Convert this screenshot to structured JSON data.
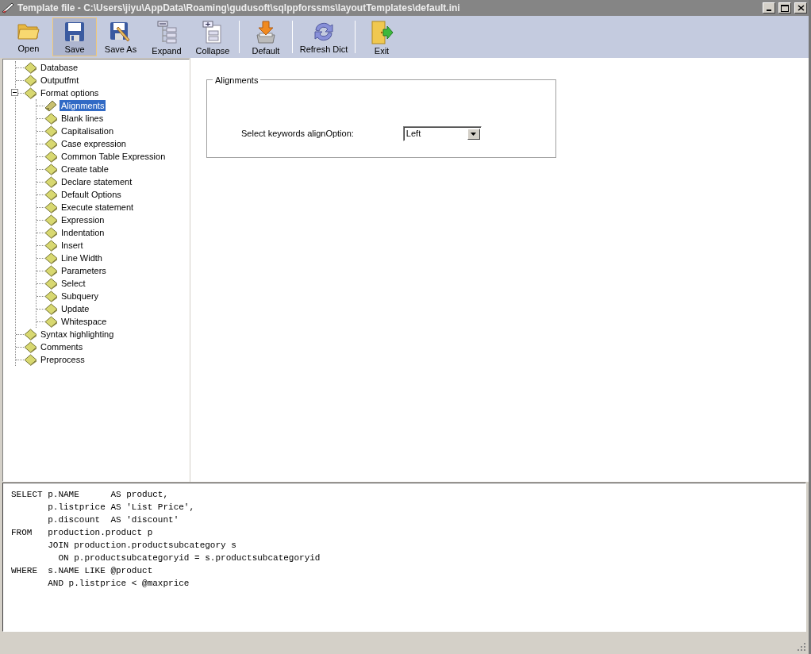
{
  "window": {
    "title": "Template file  - C:\\Users\\jiyu\\AppData\\Roaming\\gudusoft\\sqlppforssms\\layoutTemplates\\default.ini"
  },
  "toolbar": [
    {
      "kind": "button",
      "label": "Open",
      "selected": false
    },
    {
      "kind": "button",
      "label": "Save",
      "selected": true
    },
    {
      "kind": "button",
      "label": "Save As",
      "selected": false
    },
    {
      "kind": "button",
      "label": "Expand",
      "selected": false
    },
    {
      "kind": "button",
      "label": "Collapse",
      "selected": false
    },
    {
      "kind": "separator"
    },
    {
      "kind": "button",
      "label": "Default",
      "selected": false
    },
    {
      "kind": "separator"
    },
    {
      "kind": "button",
      "label": "Refresh Dict",
      "selected": false
    },
    {
      "kind": "separator"
    },
    {
      "kind": "button",
      "label": "Exit",
      "selected": false
    }
  ],
  "tree": [
    {
      "label": "Database",
      "selected": false
    },
    {
      "label": "Outputfmt",
      "selected": false
    },
    {
      "label": "Format options",
      "selected": false,
      "expanded": true,
      "children": [
        {
          "label": "Alignments",
          "selected": true
        },
        {
          "label": "Blank lines",
          "selected": false
        },
        {
          "label": "Capitalisation",
          "selected": false
        },
        {
          "label": "Case expression",
          "selected": false
        },
        {
          "label": "Common Table Expression",
          "selected": false
        },
        {
          "label": "Create table",
          "selected": false
        },
        {
          "label": "Declare statement",
          "selected": false
        },
        {
          "label": "Default Options",
          "selected": false
        },
        {
          "label": "Execute statement",
          "selected": false
        },
        {
          "label": "Expression",
          "selected": false
        },
        {
          "label": "Indentation",
          "selected": false
        },
        {
          "label": "Insert",
          "selected": false
        },
        {
          "label": "Line Width",
          "selected": false
        },
        {
          "label": "Parameters",
          "selected": false
        },
        {
          "label": "Select",
          "selected": false
        },
        {
          "label": "Subquery",
          "selected": false
        },
        {
          "label": "Update",
          "selected": false
        },
        {
          "label": "Whitespace",
          "selected": false
        }
      ]
    },
    {
      "label": "Syntax highlighting",
      "selected": false
    },
    {
      "label": "Comments",
      "selected": false
    },
    {
      "label": "Preprocess",
      "selected": false
    }
  ],
  "options_panel": {
    "group_title": "Alignments",
    "label": "Select keywords alignOption:",
    "value": "Left"
  },
  "code_preview": [
    "SELECT p.NAME      AS product,",
    "       p.listprice AS 'List Price',",
    "       p.discount  AS 'discount'",
    "FROM   production.product p",
    "       JOIN production.productsubcategory s",
    "         ON p.productsubcategoryid = s.productsubcategoryid",
    "WHERE  s.NAME LIKE @product",
    "       AND p.listprice < @maxprice"
  ]
}
